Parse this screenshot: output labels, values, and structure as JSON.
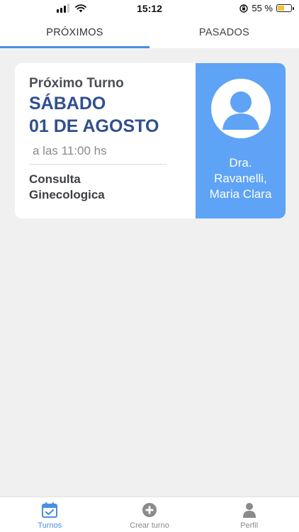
{
  "status_bar": {
    "time": "15:12",
    "battery_text": "55 %",
    "battery_level": 0.55
  },
  "tabs": [
    {
      "label": "PRÓXIMOS",
      "active": true
    },
    {
      "label": "PASADOS",
      "active": false
    }
  ],
  "appointment": {
    "label": "Próximo Turno",
    "day": "SÁBADO",
    "date": "01 DE AGOSTO",
    "time": "a las 11:00 hs",
    "type_line1": "Consulta",
    "type_line2": "Ginecologica",
    "doctor_line1": "Dra.",
    "doctor_line2": "Ravanelli,",
    "doctor_line3": "Maria Clara",
    "accent_color": "#5ea3f5",
    "title_color": "#2f4f8f"
  },
  "bottom_nav": [
    {
      "label": "Turnos",
      "icon": "calendar-check-icon",
      "active": true
    },
    {
      "label": "Crear turno",
      "icon": "plus-circle-icon",
      "active": false
    },
    {
      "label": "Perfil",
      "icon": "person-icon",
      "active": false
    }
  ]
}
